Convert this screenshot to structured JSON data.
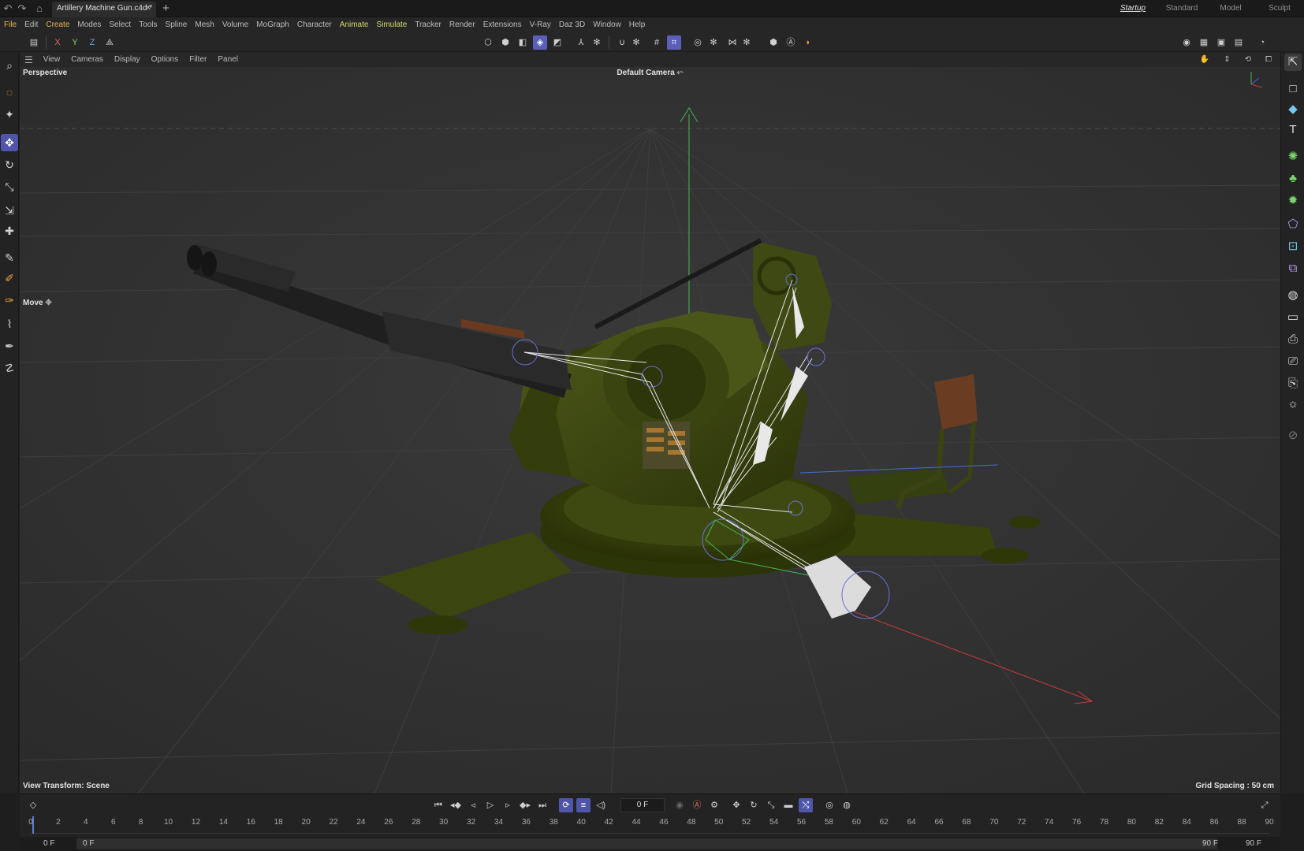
{
  "window": {
    "tab_title": "Artillery Machine Gun.c4d *",
    "layouts": [
      "Startup",
      "Standard",
      "Model",
      "Sculpt"
    ],
    "active_layout": "Startup"
  },
  "menu": [
    "File",
    "Edit",
    "Create",
    "Modes",
    "Select",
    "Tools",
    "Spline",
    "Mesh",
    "Volume",
    "MoGraph",
    "Character",
    "Animate",
    "Simulate",
    "Tracker",
    "Render",
    "Extensions",
    "V-Ray",
    "Daz 3D",
    "Window",
    "Help"
  ],
  "axis_toggles": [
    "X",
    "Y",
    "Z"
  ],
  "viewport_menu": [
    "View",
    "Cameras",
    "Display",
    "Options",
    "Filter",
    "Panel"
  ],
  "viewport": {
    "projection": "Perspective",
    "camera": "Default Camera",
    "active_tool": "Move",
    "view_transform": "View Transform: Scene",
    "grid_spacing": "Grid Spacing : 50 cm"
  },
  "timeline": {
    "current_frame": "0 F",
    "ticks": [
      "0",
      "2",
      "4",
      "6",
      "8",
      "10",
      "12",
      "14",
      "16",
      "18",
      "20",
      "22",
      "24",
      "26",
      "28",
      "30",
      "32",
      "34",
      "36",
      "38",
      "40",
      "42",
      "44",
      "46",
      "48",
      "50",
      "52",
      "54",
      "56",
      "58",
      "60",
      "62",
      "64",
      "66",
      "68",
      "70",
      "72",
      "74",
      "76",
      "78",
      "80",
      "82",
      "84",
      "86",
      "88",
      "90"
    ],
    "range_start": "0 F",
    "range_start_inner": "0 F",
    "range_end_inner": "90 F",
    "range_end": "90 F"
  },
  "colors": {
    "accent": "#5a5fb8",
    "menu_highlight": "#e8b34a",
    "viewport_bg": "#303030",
    "model_green": "#3f4a14"
  }
}
